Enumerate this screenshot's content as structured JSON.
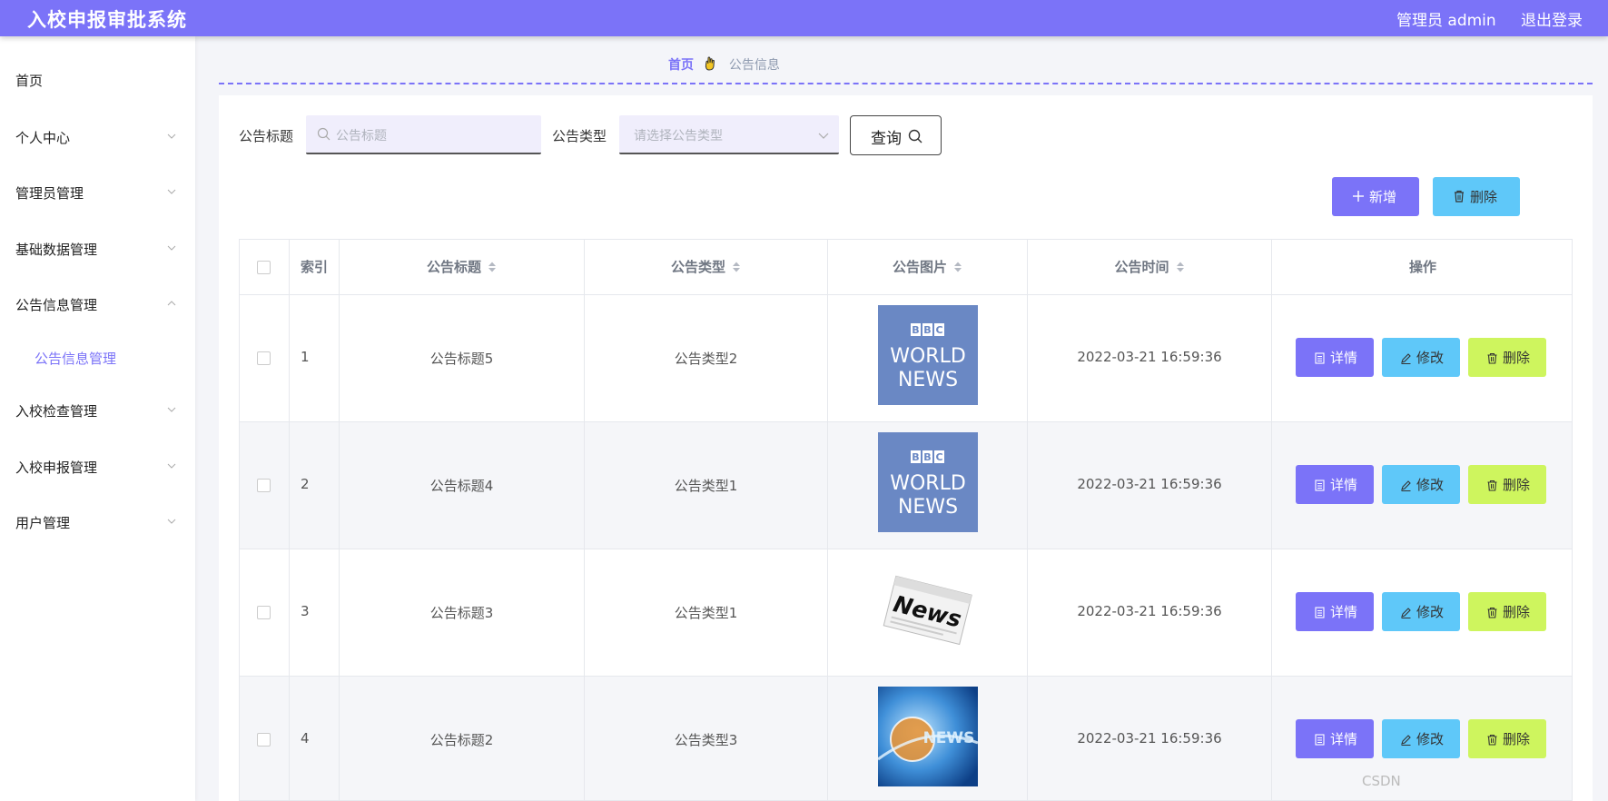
{
  "app": {
    "title": "入校申报审批系统",
    "user_label": "管理员 admin",
    "logout_label": "退出登录"
  },
  "sidebar": {
    "items": [
      {
        "label": "首页"
      },
      {
        "label": "个人中心"
      },
      {
        "label": "管理员管理"
      },
      {
        "label": "基础数据管理"
      },
      {
        "label": "公告信息管理"
      },
      {
        "label": "入校检查管理"
      },
      {
        "label": "入校申报管理"
      },
      {
        "label": "用户管理"
      }
    ],
    "subitems": [
      {
        "label": "公告信息管理"
      }
    ]
  },
  "breadcrumb": {
    "home": "首页",
    "current": "公告信息"
  },
  "search": {
    "title_label": "公告标题",
    "title_placeholder": "公告标题",
    "type_label": "公告类型",
    "type_placeholder": "请选择公告类型",
    "query_label": "查询"
  },
  "actions": {
    "add_label": "新增",
    "delete_label": "删除"
  },
  "table": {
    "headers": {
      "index": "索引",
      "title": "公告标题",
      "type": "公告类型",
      "image": "公告图片",
      "time": "公告时间",
      "ops": "操作"
    },
    "rows": [
      {
        "index": "1",
        "title": "公告标题5",
        "type": "公告类型2",
        "image": "bbc-world-news",
        "time": "2022-03-21 16:59:36"
      },
      {
        "index": "2",
        "title": "公告标题4",
        "type": "公告类型1",
        "image": "bbc-world-news",
        "time": "2022-03-21 16:59:36"
      },
      {
        "index": "3",
        "title": "公告标题3",
        "type": "公告类型1",
        "image": "newspaper-news",
        "time": "2022-03-21 16:59:36"
      },
      {
        "index": "4",
        "title": "公告标题2",
        "type": "公告类型3",
        "image": "globe-news",
        "time": "2022-03-21 16:59:36"
      }
    ],
    "row_actions": {
      "detail": "详情",
      "edit": "修改",
      "delete": "删除"
    }
  },
  "thumbs": {
    "bbc_line1": "BBC",
    "bbc_line2": "WORLD",
    "bbc_line3": "NEWS",
    "paper_word": "News",
    "globe_word": "NEWS"
  },
  "watermark": "CSDN",
  "colors": {
    "primary": "#7b73f8",
    "info": "#5fc8f9",
    "lime": "#cef55e"
  }
}
